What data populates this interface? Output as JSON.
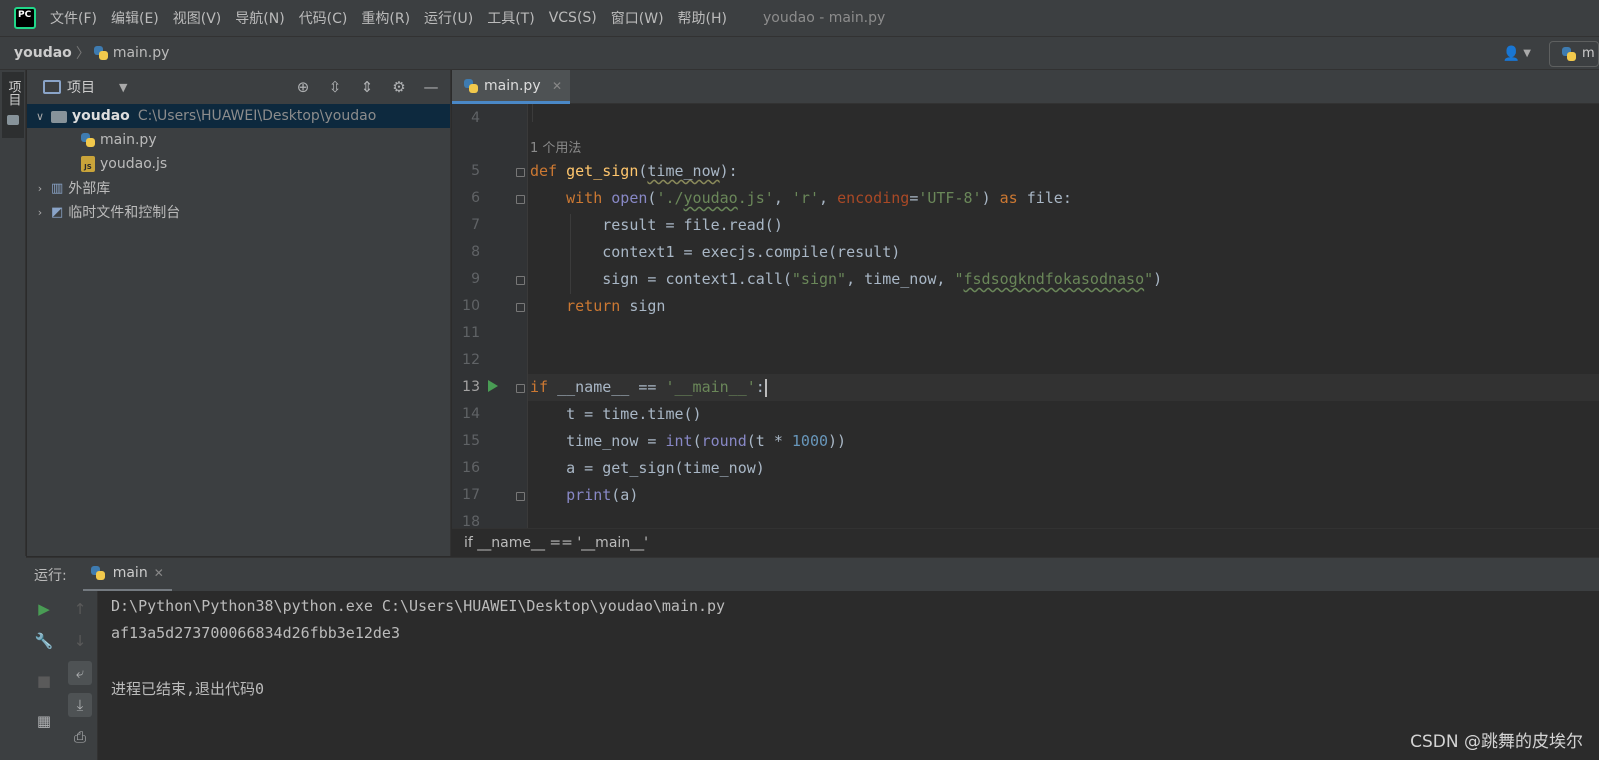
{
  "menubar": {
    "items": [
      "文件(F)",
      "编辑(E)",
      "视图(V)",
      "导航(N)",
      "代码(C)",
      "重构(R)",
      "运行(U)",
      "工具(T)",
      "VCS(S)",
      "窗口(W)",
      "帮助(H)"
    ],
    "window_title": "youdao - main.py"
  },
  "navbar": {
    "project": "youdao",
    "file": "main.py",
    "run_config": "m"
  },
  "left_stripe": {
    "project_tab": "项目"
  },
  "project_panel": {
    "title": "项目",
    "tree": [
      {
        "label": "youdao",
        "path": "C:\\Users\\HUAWEI\\Desktop\\youdao"
      },
      {
        "label": "main.py"
      },
      {
        "label": "youdao.js"
      },
      {
        "label": "外部库"
      },
      {
        "label": "临时文件和控制台"
      }
    ]
  },
  "editor": {
    "tab_label": "main.py",
    "usage_hint": "1 个用法",
    "line_numbers": [
      "4",
      "5",
      "6",
      "7",
      "8",
      "9",
      "10",
      "11",
      "12",
      "13",
      "14",
      "15",
      "16",
      "17",
      "18"
    ],
    "breadcrumb": "if __name__ == '__main__'"
  },
  "run_panel": {
    "label": "运行:",
    "tab": "main",
    "output": [
      "D:\\Python\\Python38\\python.exe C:\\Users\\HUAWEI\\Desktop\\youdao\\main.py",
      "af13a5d273700066834d26fbb3e12de3",
      "",
      "进程已结束,退出代码0"
    ]
  },
  "watermark": "CSDN @跳舞的皮埃尔",
  "colors": {
    "keyword": "#cc7832",
    "string": "#6a8759",
    "function": "#ffc66d",
    "number": "#6897bb",
    "builtin": "#8888c6",
    "selection": "#0d293e",
    "run_green": "#499c54"
  }
}
